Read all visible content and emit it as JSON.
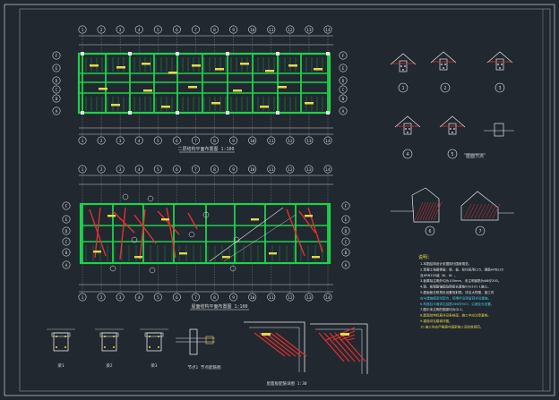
{
  "drawing": {
    "plan1_axes_top": [
      "1",
      "2",
      "3",
      "4",
      "5",
      "6",
      "7",
      "8",
      "9",
      "10",
      "11",
      "12",
      "13",
      "14"
    ],
    "plan1_axes_left": [
      "F",
      "E",
      "D",
      "C",
      "B",
      "A"
    ],
    "plan1_title": "二层结构平面布置图 1:100",
    "plan2_axes_top": [
      "1",
      "2",
      "3",
      "4",
      "5",
      "6",
      "7",
      "8",
      "9",
      "10",
      "11",
      "12",
      "13",
      "14"
    ],
    "plan2_axes_left": [
      "F",
      "E",
      "D",
      "C",
      "B",
      "A"
    ],
    "plan2_title": "屋面结构平面布置图 1:100",
    "detail_labels": [
      "1",
      "2",
      "3",
      "4",
      "5"
    ],
    "detail_caption": "屋面节点",
    "section_labels": [
      "6",
      "7"
    ],
    "bottom_captions": [
      "梁1",
      "梁2",
      "梁3",
      "节点1 节点配筋图",
      "屋面板配筋详图 1:30"
    ],
    "notes": {
      "heading": "说明：",
      "lines": [
        "1.本图结构设计依据现行国家规范。",
        "2.混凝土强度等级：梁、板、柱均采用C25，钢筋HPB235",
        "  及HRB335级（Φ、Φ）。",
        "3.板厚除注明外均为100mm，未注明钢筋为Φ8@200。",
        "4.梁、板钢筋锚固及搭接长度按03G101-1施工。",
        "5.屋面板在阳角处设置放射筋，详见大样图，施工时",
        "  应与建施图密切配合，预埋件及预留洞详见建施。",
        "6.构造柱与墙体拉结筋2Φ6@500，沿墙全长设置。",
        "7.图中未注明的圈梁均为QL1。",
        "8.屋面结构标高详见各剖面，施工中应注意复核。",
        "9.楼梯详见楼梯详图。",
        "10.施工时应严格遵守国家施工及验收规范。"
      ]
    }
  },
  "colors": {
    "background": "#212830",
    "frame": "#bfbfbf",
    "green": "#1fd14a",
    "red": "#e23030",
    "yellow": "#e8d84a",
    "white": "#e6e6e6",
    "cyan": "#49c8e0"
  }
}
